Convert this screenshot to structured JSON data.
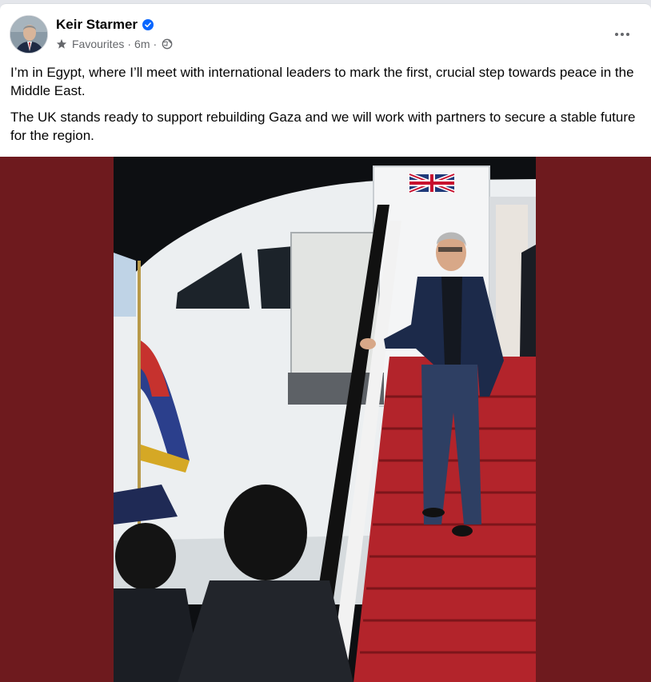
{
  "post": {
    "author": "Keir Starmer",
    "verified_icon": "verified-badge-icon",
    "audience": "Favourites",
    "time": "6m",
    "separator": "·",
    "paragraphs": [
      "I’m in Egypt, where I’ll meet with international leaders to mark the first, crucial step towards peace in the Middle East.",
      "The UK stands ready to support rebuilding Gaza and we will work with partners to secure a stable future for the region."
    ],
    "more_icon": "more-options-icon",
    "privacy_icon": "globe-icon"
  },
  "colors": {
    "accent_blue": "#0866ff",
    "secondary_text": "#65676b",
    "photo_background": "#6e1a1e",
    "carpet_red": "#b3242b"
  }
}
